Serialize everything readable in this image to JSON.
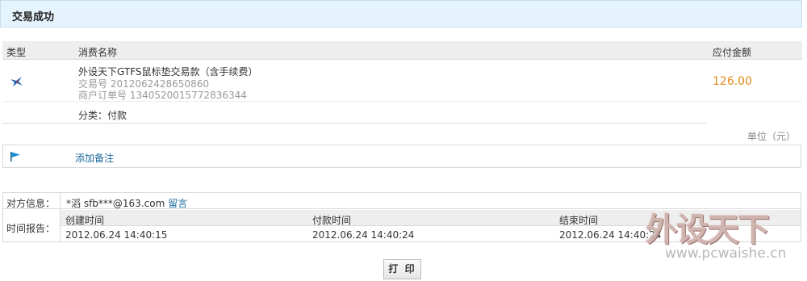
{
  "header": {
    "title": "交易成功"
  },
  "table": {
    "col_type": "类型",
    "col_name": "消费名称",
    "col_amount": "应付金额",
    "item": {
      "name": "外设天下GTFS鼠标垫交易款（含手续费）",
      "trade_no": "交易号 2012062428650860",
      "order_no": "商户订单号 1340520015772836344",
      "amount": "126.00",
      "type_icon": "bird-logo-icon"
    },
    "category": "分类：付款"
  },
  "unit": "单位（元）",
  "note": {
    "link": "添加备注",
    "icon": "flag-icon"
  },
  "info": {
    "party_label": "对方信息：",
    "party_value": "*滔 sfb***@163.com",
    "party_link": "留言",
    "time_label": "时间报告：",
    "time_cols": [
      "创建时间",
      "付款时间",
      "结束时间"
    ],
    "time_vals": [
      "2012.06.24 14:40:15",
      "2012.06.24 14:40:24",
      "2012.06.24 14:40:24"
    ]
  },
  "print_button": "打 印",
  "watermark": {
    "logo": "外设天下",
    "url": "www.pcwaishe.cn"
  },
  "colors": {
    "amount": "#e08a14",
    "link": "#1a6a9a",
    "header_bg": "#e5f3fc"
  }
}
